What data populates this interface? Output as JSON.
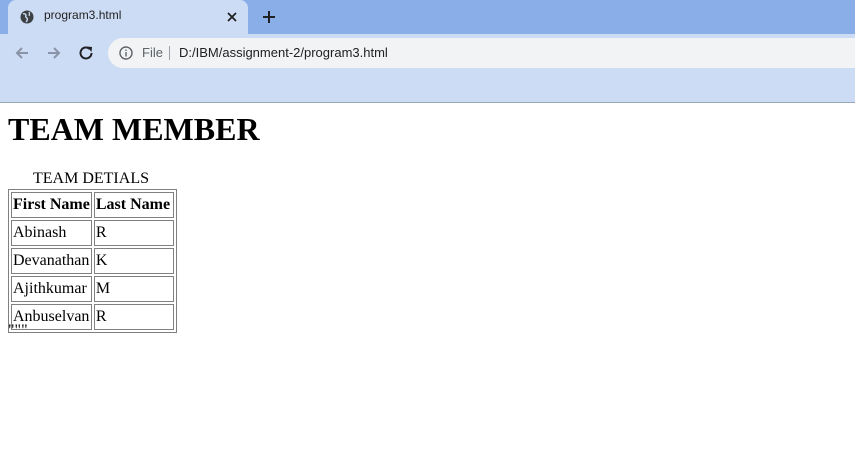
{
  "browser": {
    "tab_title": "program3.html",
    "scheme_label": "File",
    "url": "D:/IBM/assignment-2/program3.html"
  },
  "page": {
    "heading": "TEAM MEMBER",
    "table_caption": "TEAM DETIALS",
    "columns": [
      "First Name",
      "Last Name"
    ],
    "rows": [
      [
        "Abinash",
        "R"
      ],
      [
        "Devanathan",
        "K"
      ],
      [
        "Ajithkumar",
        "M"
      ],
      [
        "Anbuselvan",
        "R"
      ]
    ],
    "trailing_text": "\"\"\""
  }
}
